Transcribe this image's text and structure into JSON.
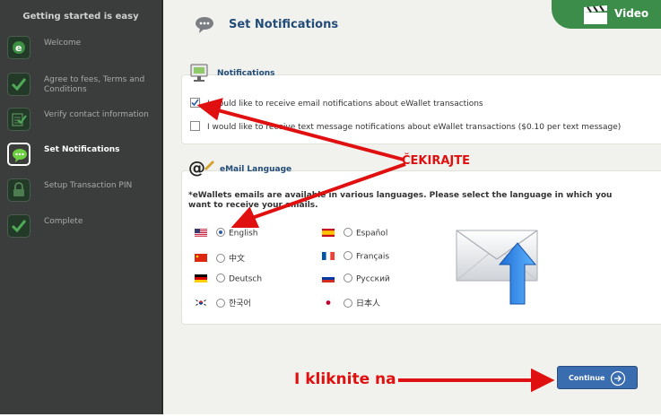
{
  "sidebar": {
    "heading": "Getting started is easy",
    "items": [
      {
        "label": "Welcome",
        "icon": "ewallet-icon"
      },
      {
        "label": "Agree to fees, Terms and Conditions",
        "icon": "checkmark-icon"
      },
      {
        "label": "Verify contact information",
        "icon": "document-check-icon"
      },
      {
        "label": "Set Notifications",
        "icon": "speech-bubble-icon",
        "active": true
      },
      {
        "label": "Setup Transaction PIN",
        "icon": "lock-icon"
      },
      {
        "label": "Complete",
        "icon": "checkmark-icon"
      }
    ]
  },
  "header": {
    "title": "Set Notifications",
    "video_label": "Video"
  },
  "notifications": {
    "title": "Notifications",
    "email_option": "I would like to receive email notifications about eWallet transactions",
    "email_checked": true,
    "sms_option": "I would like to receive text message notifications about eWallet transactions ($0.10 per text message)",
    "sms_checked": false
  },
  "language": {
    "title": "eMail Language",
    "note": "*eWallets emails are available in various languages. Please select the language in which you want to receive your emails.",
    "options": [
      {
        "label": "English",
        "selected": true
      },
      {
        "label": "Español",
        "selected": false
      },
      {
        "label": "中文",
        "selected": false
      },
      {
        "label": "Français",
        "selected": false
      },
      {
        "label": "Deutsch",
        "selected": false
      },
      {
        "label": "Русский",
        "selected": false
      },
      {
        "label": "한국어",
        "selected": false
      },
      {
        "label": "日本人",
        "selected": false
      }
    ]
  },
  "continue_label": "Continue",
  "annotations": {
    "check_label": "ČEKIRAJTE",
    "click_label": "I kliknite na"
  },
  "colors": {
    "accent": "#3a6cb0",
    "annotation": "#e01010",
    "video_tab": "#3c8c4a"
  }
}
